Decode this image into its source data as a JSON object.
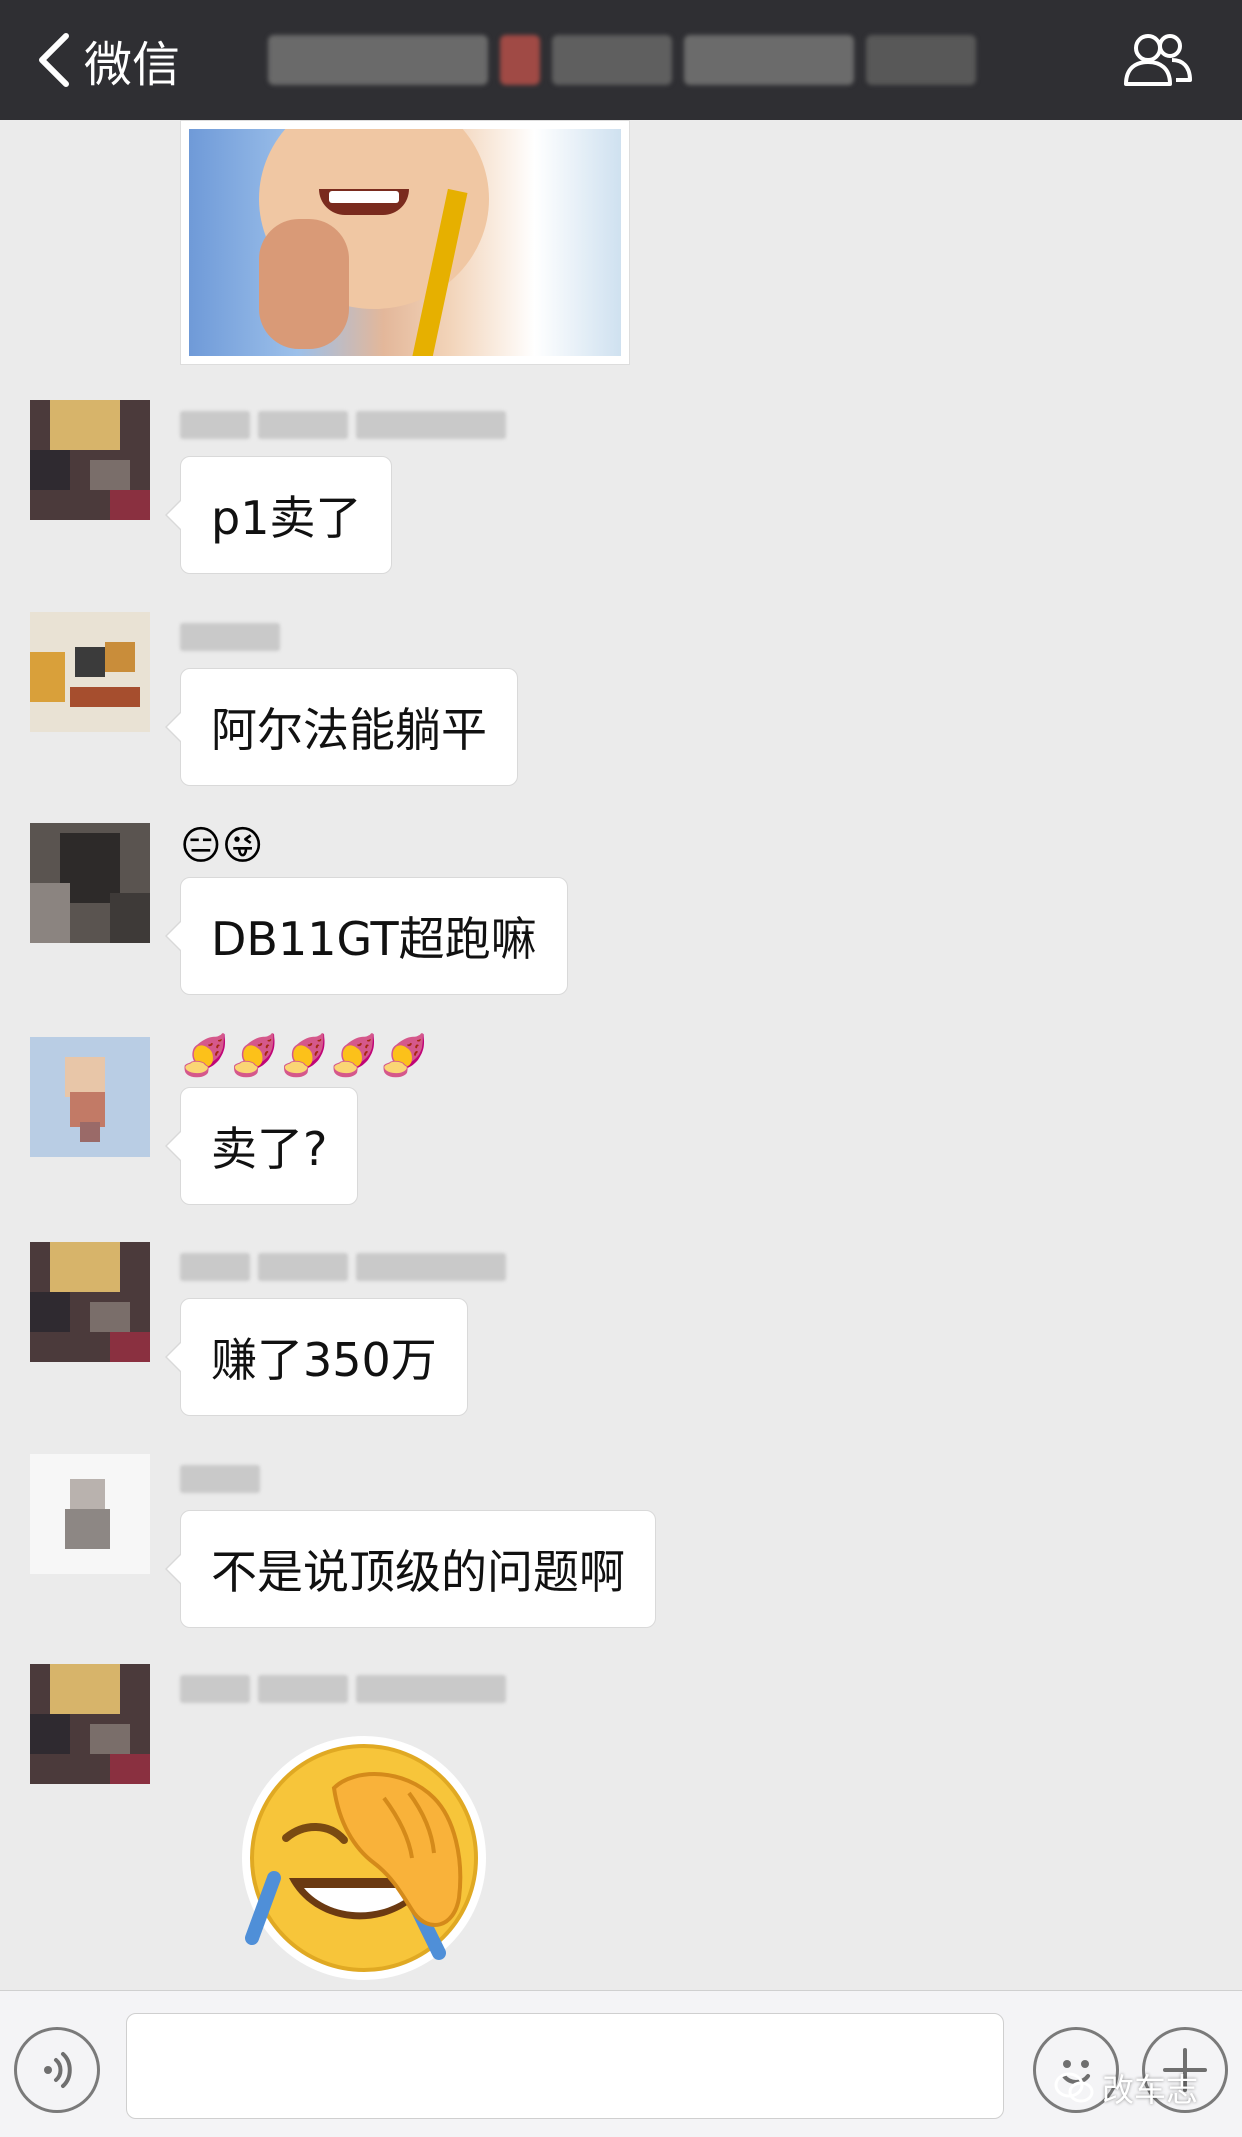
{
  "topbar": {
    "back_label": "微信"
  },
  "messages": [
    {
      "text": "p1卖了"
    },
    {
      "text": "阿尔法能躺平"
    },
    {
      "emoji_prefix": "😑😜",
      "text": "DB11GT超跑嘛"
    },
    {
      "emoji_prefix": "🍠🍠🍠🍠🍠",
      "text": "卖了?"
    },
    {
      "text": "赚了350万"
    },
    {
      "text": "不是说顶级的问题啊"
    }
  ],
  "sticker": {
    "icon": "facepalm-laugh-emoji"
  },
  "input_bar": {
    "voice_icon": "voice-icon",
    "emoji_icon": "emoji-icon",
    "plus_icon": "plus-icon",
    "input_value": ""
  },
  "watermark": {
    "text": "改车志"
  },
  "colors": {
    "topbar": "#2f2f33",
    "background": "#ebebeb",
    "bubble": "#ffffff"
  }
}
